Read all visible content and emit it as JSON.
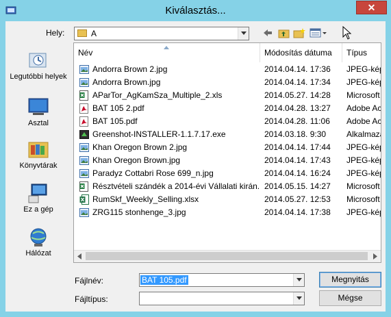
{
  "window": {
    "title": "Kiválasztás...",
    "close_label": "✕"
  },
  "toolbar": {
    "hely_label": "Hely:",
    "location_value": "A"
  },
  "places": [
    {
      "label": "Legutóbbi helyek",
      "icon": "recent-places-icon"
    },
    {
      "label": "Asztal",
      "icon": "desktop-icon"
    },
    {
      "label": "Könyvtárak",
      "icon": "libraries-icon"
    },
    {
      "label": "Ez a gép",
      "icon": "computer-icon"
    },
    {
      "label": "Hálózat",
      "icon": "network-icon"
    }
  ],
  "columns": {
    "name": "Név",
    "modified": "Módosítás dátuma",
    "type": "Típus"
  },
  "files": [
    {
      "name": "Andorra Brown 2.jpg",
      "modified": "2014.04.14. 17:36",
      "type": "JPEG-kép",
      "kind": "jpg"
    },
    {
      "name": "Andorra Brown.jpg",
      "modified": "2014.04.14. 17:34",
      "type": "JPEG-kép",
      "kind": "jpg"
    },
    {
      "name": "AParTor_AgKamSza_Multiple_2.xls",
      "modified": "2014.05.27. 14:28",
      "type": "Microsoft",
      "kind": "xls"
    },
    {
      "name": "BAT 105 2.pdf",
      "modified": "2014.04.28. 13:27",
      "type": "Adobe Ac",
      "kind": "pdf"
    },
    {
      "name": "BAT 105.pdf",
      "modified": "2014.04.28. 11:06",
      "type": "Adobe Ac",
      "kind": "pdf"
    },
    {
      "name": "Greenshot-INSTALLER-1.1.7.17.exe",
      "modified": "2014.03.18. 9:30",
      "type": "Alkalmazá",
      "kind": "exe"
    },
    {
      "name": "Khan Oregon Brown 2.jpg",
      "modified": "2014.04.14. 17:44",
      "type": "JPEG-kép",
      "kind": "jpg"
    },
    {
      "name": "Khan Oregon Brown.jpg",
      "modified": "2014.04.14. 17:43",
      "type": "JPEG-kép",
      "kind": "jpg"
    },
    {
      "name": "Paradyz Cottabri Rose 699_n.jpg",
      "modified": "2014.04.14. 16:24",
      "type": "JPEG-kép",
      "kind": "jpg"
    },
    {
      "name": "Résztvételi szándék a 2014-évi Vállalati kirán...",
      "modified": "2014.05.15. 14:27",
      "type": "Microsoft",
      "kind": "xls"
    },
    {
      "name": "RumSkf_Weekly_Selling.xlsx",
      "modified": "2014.05.27. 12:53",
      "type": "Microsoft",
      "kind": "xlsx"
    },
    {
      "name": "ZRG115 stonhenge_3.jpg",
      "modified": "2014.04.14. 17:38",
      "type": "JPEG-kép",
      "kind": "jpg"
    }
  ],
  "footer": {
    "filename_label": "Fájlnév:",
    "filename_value": "BAT 105.pdf",
    "filetype_label": "Fájltípus:",
    "filetype_value": "",
    "open_label": "Megnyitás",
    "cancel_label": "Mégse"
  }
}
